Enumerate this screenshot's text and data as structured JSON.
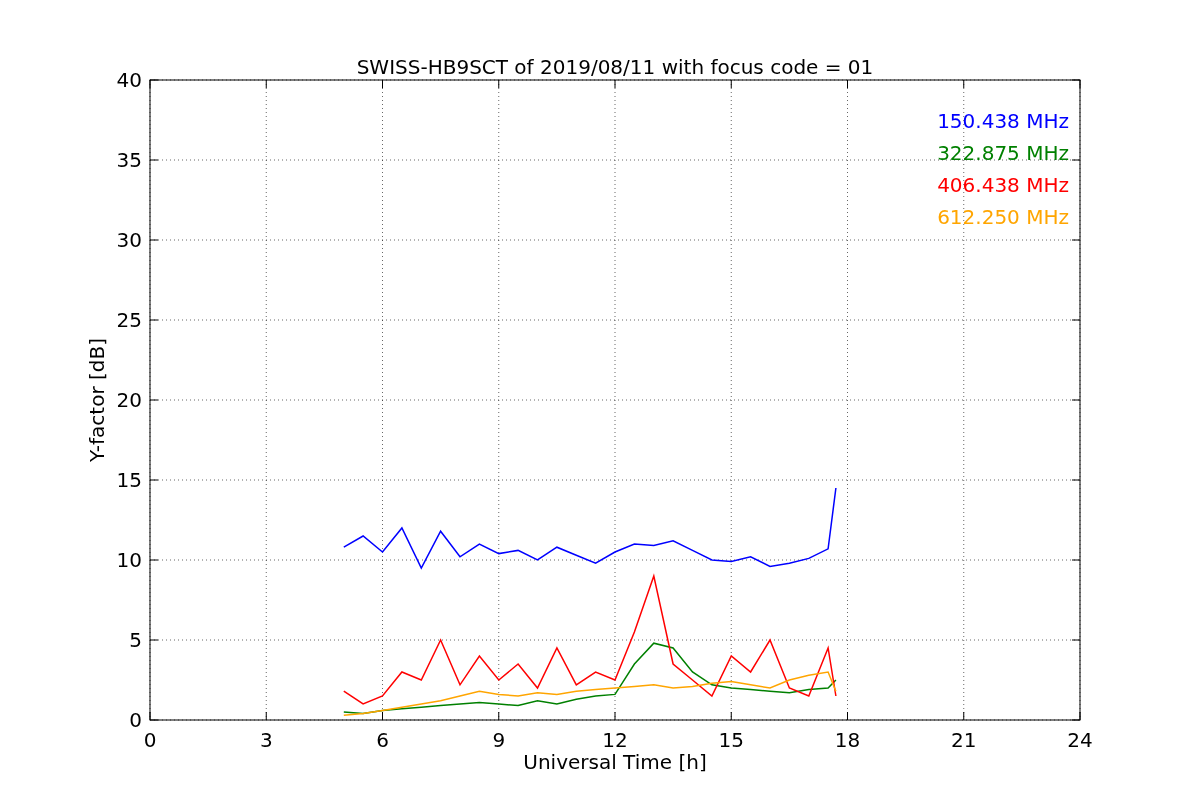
{
  "figure": {
    "chart_data": {
      "type": "line",
      "title": "SWISS-HB9SCT of 2019/08/11 with focus code = 01",
      "xlabel": "Universal Time [h]",
      "ylabel": "Y-factor [dB]",
      "x": [
        5,
        5.5,
        6,
        6.5,
        7,
        7.5,
        8,
        8.5,
        9,
        9.5,
        10,
        10.5,
        11,
        11.5,
        12,
        12.5,
        13,
        13.5,
        14,
        14.5,
        15,
        15.5,
        16,
        16.5,
        17,
        17.5,
        17.7
      ],
      "series": [
        {
          "name": "150.438 MHz",
          "color": "#0000ff",
          "values": [
            10.8,
            11.5,
            10.5,
            12.0,
            9.5,
            11.8,
            10.2,
            11.0,
            10.4,
            10.6,
            10.0,
            10.8,
            10.3,
            9.8,
            10.5,
            11.0,
            10.9,
            11.2,
            10.6,
            10.0,
            9.9,
            10.2,
            9.6,
            9.8,
            10.1,
            10.7,
            14.5
          ]
        },
        {
          "name": "322.875 MHz",
          "color": "#008000",
          "values": [
            0.5,
            0.4,
            0.6,
            0.7,
            0.8,
            0.9,
            1.0,
            1.1,
            1.0,
            0.9,
            1.2,
            1.0,
            1.3,
            1.5,
            1.6,
            3.5,
            4.8,
            4.5,
            3.0,
            2.2,
            2.0,
            1.9,
            1.8,
            1.7,
            1.9,
            2.0,
            2.5
          ]
        },
        {
          "name": "406.438 MHz",
          "color": "#ff0000",
          "values": [
            1.8,
            1.0,
            1.5,
            3.0,
            2.5,
            5.0,
            2.2,
            4.0,
            2.5,
            3.5,
            2.0,
            4.5,
            2.2,
            3.0,
            2.5,
            5.5,
            9.0,
            3.5,
            2.5,
            1.5,
            4.0,
            3.0,
            5.0,
            2.0,
            1.5,
            4.5,
            1.5
          ]
        },
        {
          "name": "612.250 MHz",
          "color": "#ffa500",
          "values": [
            0.3,
            0.4,
            0.6,
            0.8,
            1.0,
            1.2,
            1.5,
            1.8,
            1.6,
            1.5,
            1.7,
            1.6,
            1.8,
            1.9,
            2.0,
            2.1,
            2.2,
            2.0,
            2.1,
            2.3,
            2.4,
            2.2,
            2.0,
            2.5,
            2.8,
            3.0,
            1.8
          ]
        }
      ],
      "grid": true,
      "xlim": [
        0,
        24
      ],
      "ylim": [
        0,
        40
      ],
      "xticks": [
        0,
        3,
        6,
        9,
        12,
        15,
        18,
        21,
        24
      ],
      "yticks": [
        0,
        5,
        10,
        15,
        20,
        25,
        30,
        35,
        40
      ]
    }
  }
}
